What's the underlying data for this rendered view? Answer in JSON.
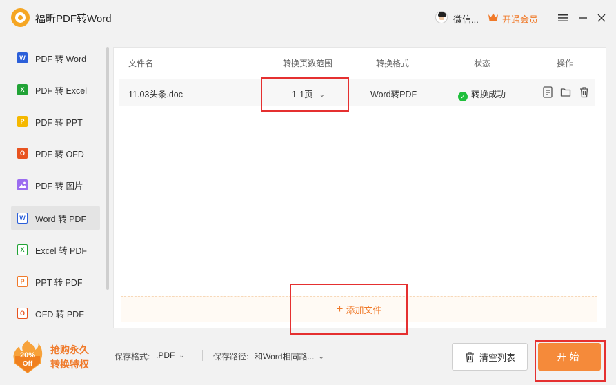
{
  "app": {
    "title": "福昕PDF转Word"
  },
  "header": {
    "user_name": "微信...",
    "vip_label": "开通会员",
    "accent": "#f07a2a"
  },
  "sidebar": {
    "items": [
      {
        "label": "PDF 转 Word",
        "icon_letter": "W",
        "color": "#2b5fd9"
      },
      {
        "label": "PDF 转 Excel",
        "icon_letter": "X",
        "color": "#21a336"
      },
      {
        "label": "PDF 转 PPT",
        "icon_letter": "P",
        "color": "#f5b800"
      },
      {
        "label": "PDF 转 OFD",
        "icon_letter": "O",
        "color": "#e8531f"
      },
      {
        "label": "PDF 转 图片",
        "icon_letter": "",
        "color": "#9b6cf0"
      },
      {
        "label": "Word 转 PDF",
        "icon_letter": "W",
        "color": "#2b5fd9"
      },
      {
        "label": "Excel 转 PDF",
        "icon_letter": "X",
        "color": "#21a336"
      },
      {
        "label": "PPT 转 PDF",
        "icon_letter": "P",
        "color": "#f07a2a"
      },
      {
        "label": "OFD 转 PDF",
        "icon_letter": "O",
        "color": "#e8531f"
      }
    ],
    "active_index": 5
  },
  "table": {
    "headers": {
      "filename": "文件名",
      "page_range": "转换页数范围",
      "format": "转换格式",
      "status": "状态",
      "actions": "操作"
    },
    "rows": [
      {
        "filename": "11.03头条.doc",
        "page_range": "1-1页",
        "format": "Word转PDF",
        "status": "转换成功"
      }
    ]
  },
  "add_file": {
    "label": "添加文件"
  },
  "bottom": {
    "promo_badge_top": "20%",
    "promo_badge_bottom": "Off",
    "promo_line1": "抢购永久",
    "promo_line2": "转换特权",
    "format_label": "保存格式:",
    "format_value": ".PDF",
    "path_label": "保存路径:",
    "path_value": "和Word相同路...",
    "clear_label": "清空列表",
    "start_label": "开始"
  }
}
